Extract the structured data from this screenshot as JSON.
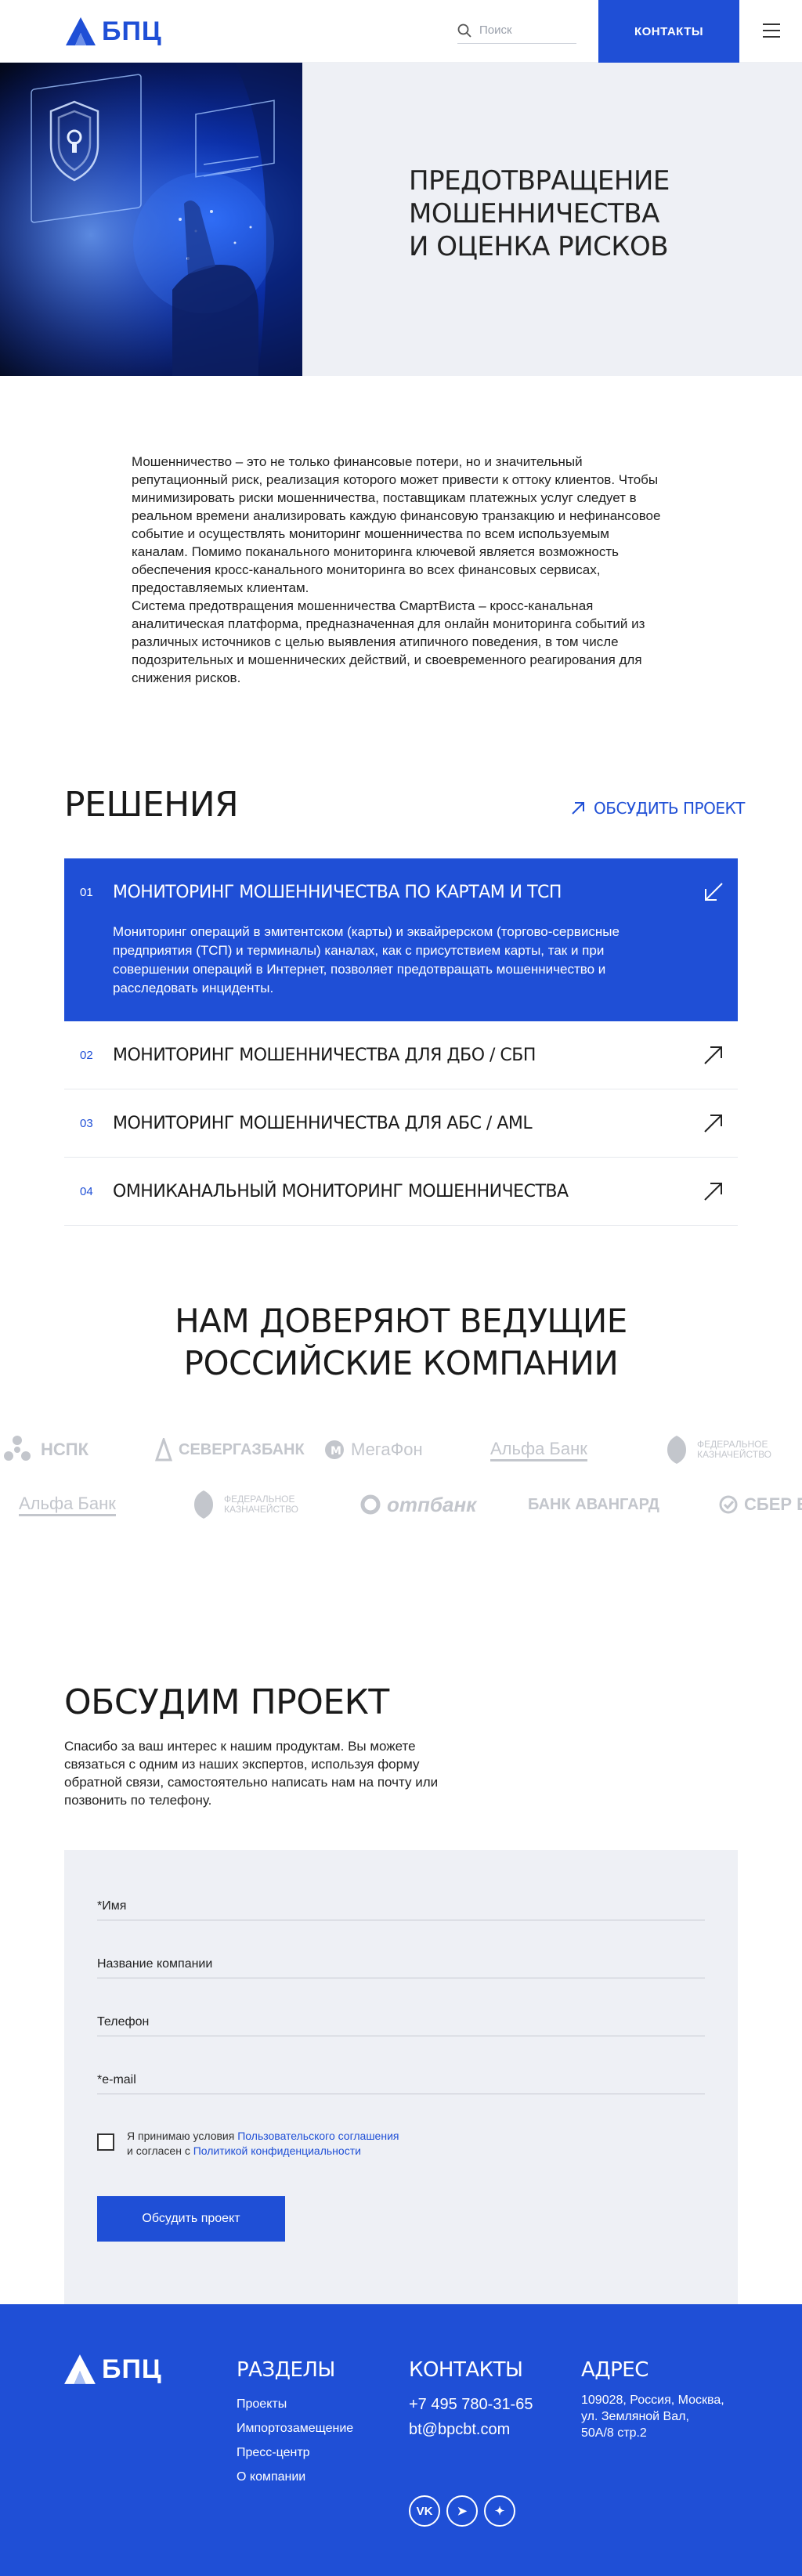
{
  "header": {
    "logo_text": "БПЦ",
    "search_placeholder": "Поиск",
    "contacts_label": "КОНТАКТЫ"
  },
  "hero": {
    "title_lines": [
      "ПРЕДОТВРАЩЕНИЕ",
      "МОШЕННИЧЕСТВА",
      "И ОЦЕНКА РИСКОВ"
    ]
  },
  "intro": {
    "paragraph_1": "Мошенничество – это не только финансовые потери, но и значительный репутационный риск, реализация которого может привести к оттоку клиентов. Чтобы минимизировать риски мошенничества, поставщикам платежных услуг следует в реальном времени анализировать каждую финансовую транзакцию и нефинансовое событие и осуществлять мониторинг мошенничества по всем используемым каналам. Помимо поканального мониторинга ключевой является возможность обеспечения кросс-канального мониторинга во всех финансовых сервисах, предоставляемых клиентам.",
    "paragraph_2": "Система предотвращения мошенничества СмартВиста – кросс-канальная аналитическая платформа, предназначенная для онлайн мониторинга событий из различных источников с целью выявления атипичного поведения, в том числе подозрительных и мошеннических действий, и своевременного реагирования для снижения рисков."
  },
  "solutions": {
    "title": "РЕШЕНИЯ",
    "discuss_link": "ОБСУДИТЬ ПРОЕКТ",
    "items": [
      {
        "num": "01",
        "name": "МОНИТОРИНГ МОШЕННИЧЕСТВА ПО КАРТАМ И ТСП",
        "desc": "Мониторинг операций в эмитентском (карты) и эквайрерском (торгово-сервисные предприятия (ТСП) и терминалы) каналах, как с присутствием карты, так и при совершении операций в Интернет, позволяет предотвращать мошенничество и расследовать инциденты."
      },
      {
        "num": "02",
        "name": "МОНИТОРИНГ МОШЕННИЧЕСТВА ДЛЯ ДБО / СБП"
      },
      {
        "num": "03",
        "name": "МОНИТОРИНГ МОШЕННИЧЕСТВА ДЛЯ АБС / AML"
      },
      {
        "num": "04",
        "name": "ОМНИКАНАЛЬНЫЙ МОНИТОРИНГ МОШЕННИЧЕСТВА"
      }
    ]
  },
  "trust": {
    "title_lines": [
      "НАМ ДОВЕРЯЮТ ВЕДУЩИЕ",
      "РОССИЙСКИЕ КОМПАНИИ"
    ],
    "row_1": [
      "НСПК",
      "СЕВЕРГАЗБАНК",
      "МегаФон",
      "Альфа Банк",
      "ФЕДЕРАЛЬНОЕ КАЗНАЧЕЙСТВО"
    ],
    "row_2": [
      "Альфа Банк",
      "ФЕДЕРАЛЬНОЕ КАЗНАЧЕЙСТВО",
      "отпбанк",
      "БАНК АВАНГАРД",
      "СБЕР Б"
    ]
  },
  "form": {
    "title": "ОБСУДИМ ПРОЕКТ",
    "subtitle": "Спасибо за ваш интерес к нашим продуктам. Вы можете связаться с одним из наших экспертов, используя форму обратной связи, самостоятельно написать нам на почту или позвонить по телефону.",
    "name_placeholder": "*Имя",
    "company_placeholder": "Название компании",
    "phone_placeholder": "Телефон",
    "email_placeholder": "*e-mail",
    "agree_prefix": "Я принимаю условия ",
    "agree_link_1": "Пользовательского соглашения",
    "agree_mid": "и согласен с ",
    "agree_link_2": "Политикой конфиденциальности",
    "submit_label": "Обсудить проект"
  },
  "footer": {
    "logo_text": "БПЦ",
    "sections_title": "РАЗДЕЛЫ",
    "sections": [
      "Проекты",
      "Импортозамещение",
      "Пресс-центр",
      "О компании"
    ],
    "contacts_title": "КОНТАКТЫ",
    "phone": "+7 495 780-31-65",
    "email": "bt@bpcbt.com",
    "address_title": "АДРЕС",
    "address_lines": [
      "109028, Россия, Москва,",
      "ул. Земляной Вал,",
      "50А/8 стр.2"
    ],
    "socials": [
      "vk-icon",
      "telegram-icon",
      "dzen-icon"
    ],
    "social_labels": [
      "VK",
      "➤",
      "✦"
    ]
  },
  "colors": {
    "brand_blue": "#1f4fd6",
    "light_bg": "#eef0f5",
    "logo_gray": "#c3c6cc"
  }
}
